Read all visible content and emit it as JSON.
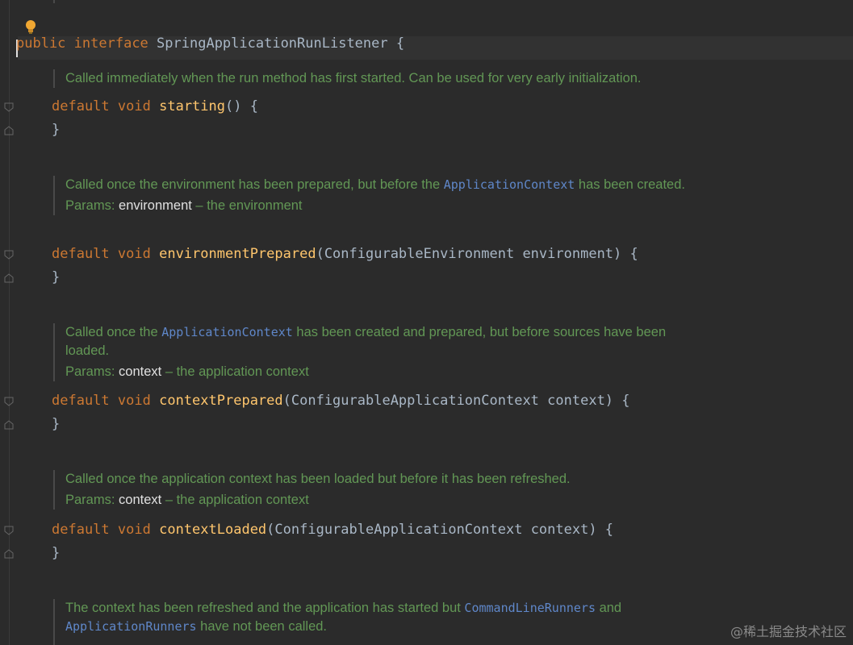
{
  "editor": {
    "header_line": {
      "kw_public": "public",
      "kw_interface": "interface",
      "name": "SpringApplicationRunListener",
      "brace": "{"
    },
    "methods": [
      {
        "doc_text_before": "Called immediately when the run method has first started. Can be used for very early initialization.",
        "doc_link": "",
        "doc_text_after": "",
        "param_label": "",
        "param_name": "",
        "param_desc": "",
        "kw_default": "default",
        "kw_void": "void",
        "name": "starting",
        "signature_rest": "() {",
        "close": "}"
      },
      {
        "doc_text_before": "Called once the environment has been prepared, but before the ",
        "doc_link": "ApplicationContext",
        "doc_text_after": " has been created.",
        "param_label": "Params:",
        "param_name": "environment",
        "param_desc": " – the environment",
        "kw_default": "default",
        "kw_void": "void",
        "name": "environmentPrepared",
        "signature_rest": "(ConfigurableEnvironment environment) {",
        "close": "}"
      },
      {
        "doc_text_before": "Called once the ",
        "doc_link": "ApplicationContext",
        "doc_text_after": " has been created and prepared, but before sources have been loaded.",
        "param_label": "Params:",
        "param_name": "context",
        "param_desc": " – the application context",
        "kw_default": "default",
        "kw_void": "void",
        "name": "contextPrepared",
        "signature_rest": "(ConfigurableApplicationContext context) {",
        "close": "}"
      },
      {
        "doc_text_before": "Called once the application context has been loaded but before it has been refreshed.",
        "doc_link": "",
        "doc_text_after": "",
        "param_label": "Params:",
        "param_name": "context",
        "param_desc": " – the application context",
        "kw_default": "default",
        "kw_void": "void",
        "name": "contextLoaded",
        "signature_rest": "(ConfigurableApplicationContext context) {",
        "close": "}"
      }
    ],
    "last_doc": {
      "text_before": "The context has been refreshed and the application has started but ",
      "link1": "CommandLineRunners",
      "text_mid": " and ",
      "link2": "ApplicationRunners",
      "text_after": " have not been called."
    }
  },
  "watermark": "@稀土掘金技术社区",
  "icons": {
    "bulb": "lightbulb-icon",
    "fold": "fold-marker-icon"
  },
  "colors": {
    "background": "#2b2b2b",
    "keyword": "#cc7832",
    "method": "#ffc66d",
    "doc_text": "#629755",
    "doc_link": "#5f87c9"
  }
}
